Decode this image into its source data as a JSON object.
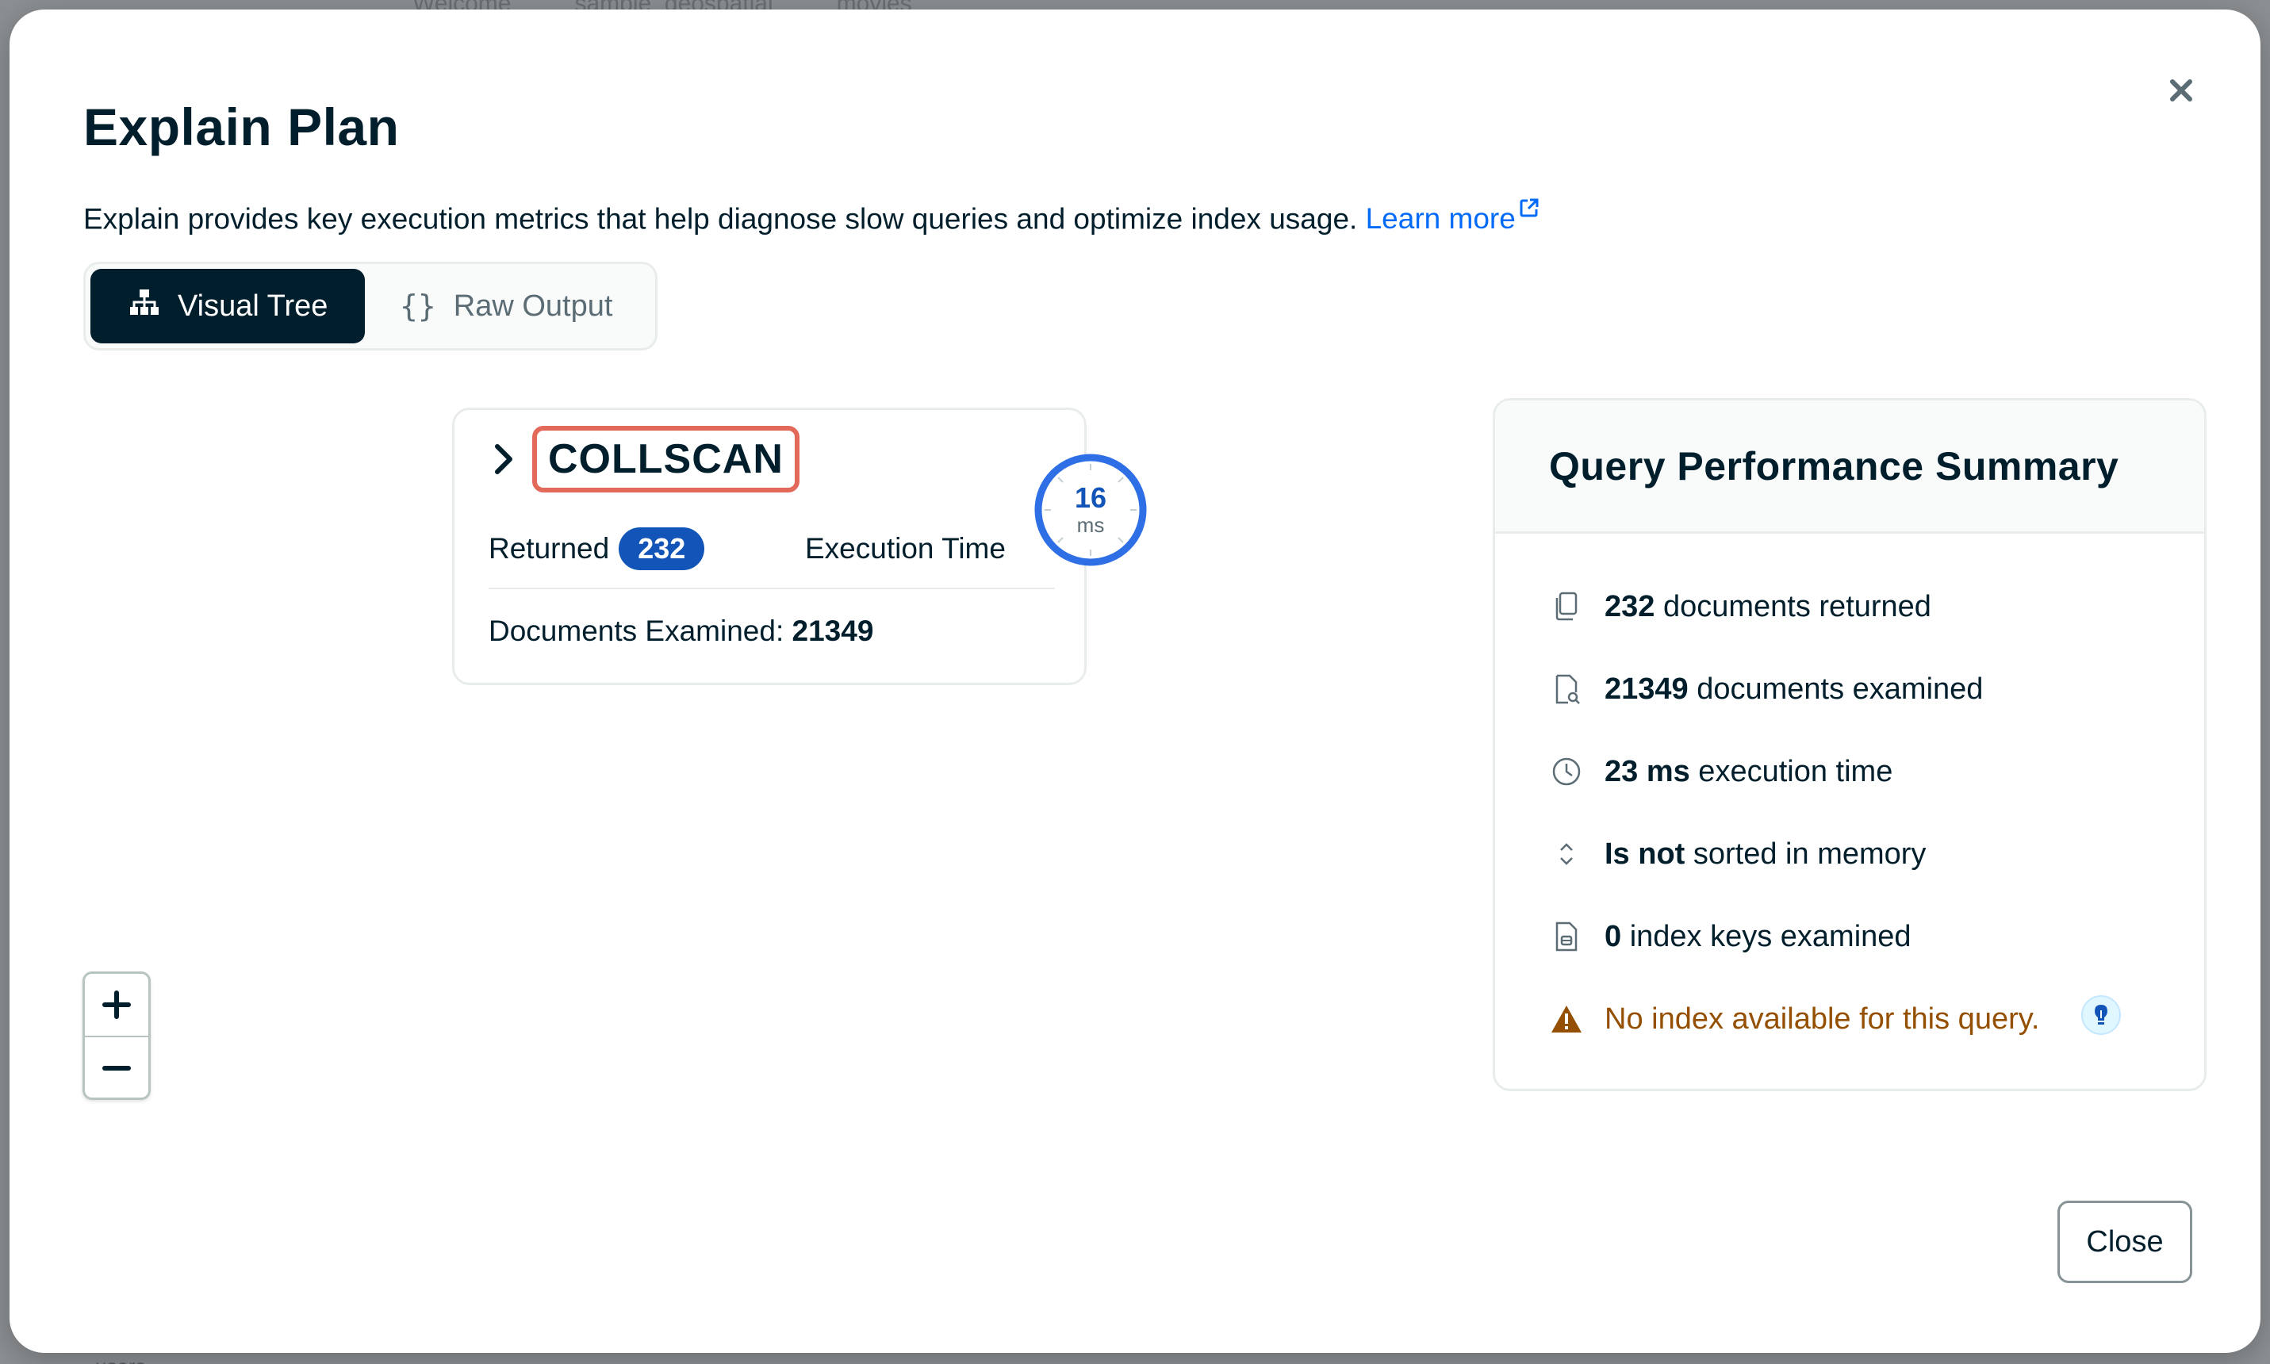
{
  "background": {
    "tabs": [
      "Welcome",
      "sample_geospatial",
      "movies"
    ],
    "bottom_item": "users"
  },
  "modal": {
    "title": "Explain Plan",
    "description": "Explain provides key execution metrics that help diagnose slow queries and optimize index usage.",
    "learn_more": "Learn more",
    "view_toggle": {
      "visual_tree": "Visual Tree",
      "raw_output": "Raw Output",
      "selected": "Visual Tree"
    },
    "stage": {
      "name": "COLLSCAN",
      "returned_label": "Returned",
      "returned_value": "232",
      "exec_time_label": "Execution Time",
      "exec_time_value": "16",
      "exec_time_unit": "ms",
      "docs_examined_label": "Documents Examined:",
      "docs_examined_value": "21349"
    },
    "summary": {
      "title": "Query Performance Summary",
      "rows": [
        {
          "bold": "232",
          "text": " documents returned",
          "icon": "copy-icon"
        },
        {
          "bold": "21349",
          "text": " documents examined",
          "icon": "file-search-icon"
        },
        {
          "bold": "23 ms",
          "text": " execution time",
          "icon": "clock-icon"
        },
        {
          "bold": "Is not",
          "text": " sorted in memory",
          "icon": "sort-icon"
        },
        {
          "bold": "0",
          "text": " index keys examined",
          "icon": "index-file-icon"
        }
      ],
      "warning": "No index available for this query."
    },
    "close_label": "Close"
  },
  "colors": {
    "accent_blue": "#1254b7",
    "link_blue": "#016bf8",
    "highlight_red": "#e36a5a",
    "warning_brown": "#944f01",
    "dark": "#001e2b"
  }
}
